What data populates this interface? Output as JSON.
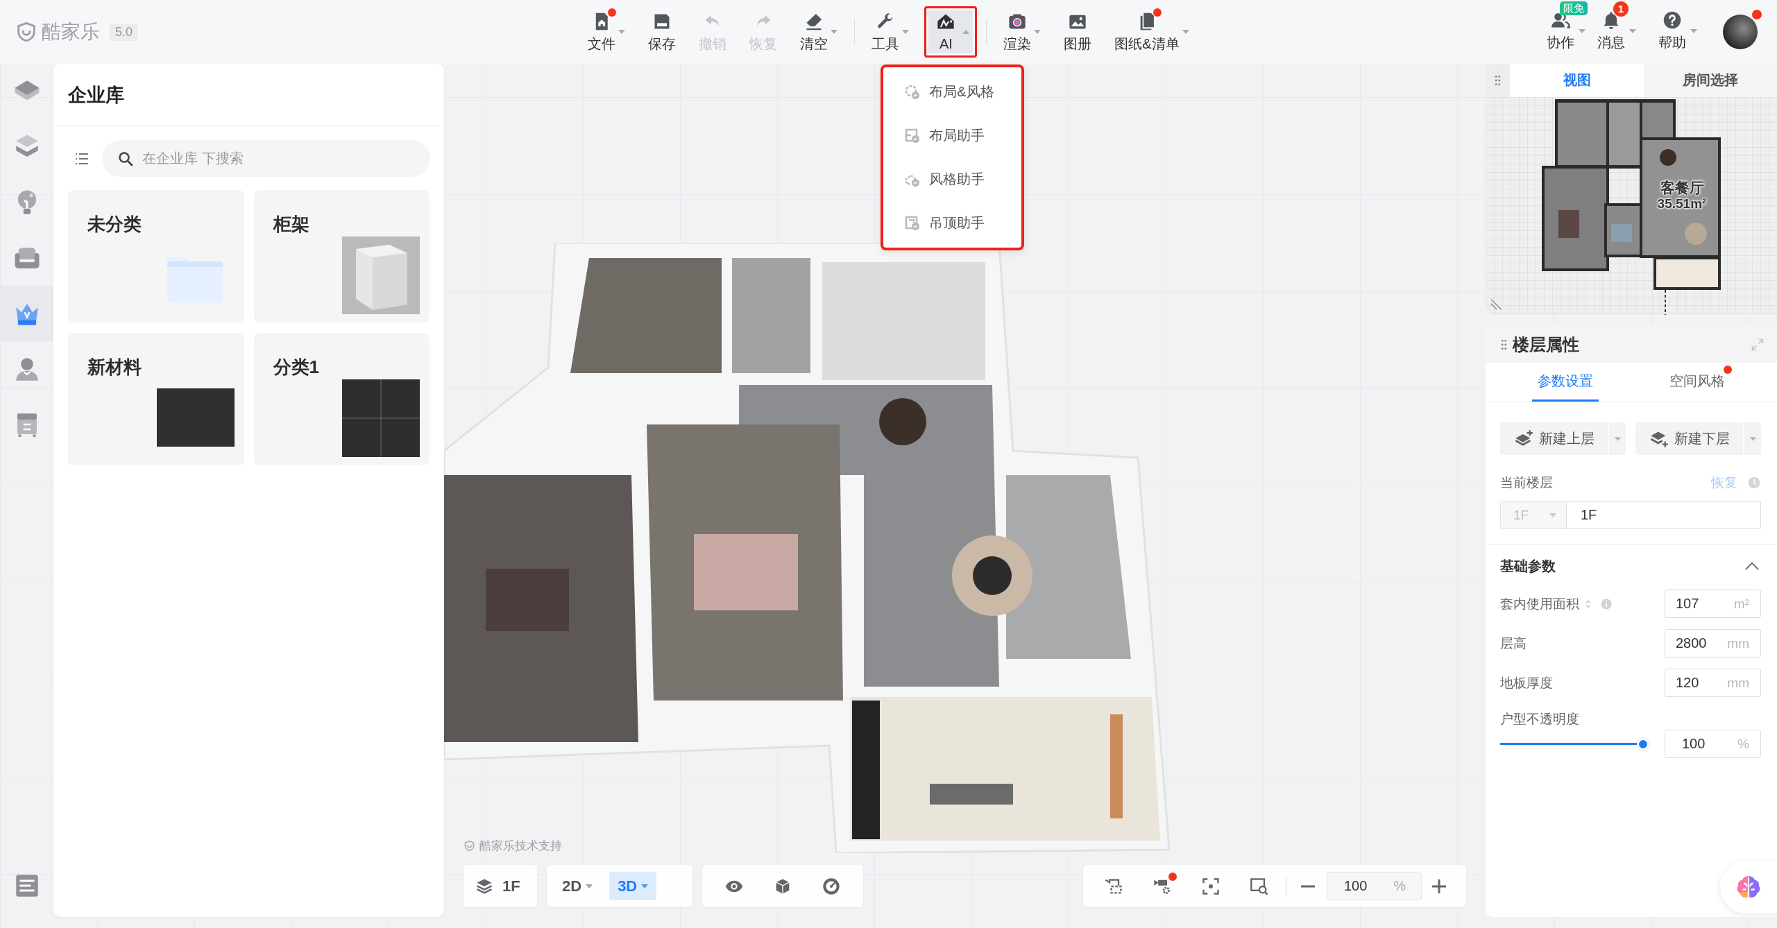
{
  "header": {
    "logo": "酷家乐",
    "version": "5.0"
  },
  "toolbar": [
    {
      "items": [
        {
          "label": "文件",
          "dropdown": true,
          "expanded": false,
          "disabled": false,
          "dot": true,
          "selected": false,
          "annotated": false
        },
        {
          "label": "保存",
          "dropdown": false,
          "disabled": false,
          "dot": false,
          "selected": false,
          "annotated": false
        },
        {
          "label": "撤销",
          "dropdown": false,
          "disabled": true,
          "dot": false,
          "selected": false,
          "annotated": false
        },
        {
          "label": "恢复",
          "dropdown": false,
          "disabled": true,
          "dot": false,
          "selected": false,
          "annotated": false
        },
        {
          "label": "清空",
          "dropdown": true,
          "expanded": false,
          "disabled": false,
          "dot": false,
          "selected": false,
          "annotated": false
        }
      ]
    },
    {
      "items": [
        {
          "label": "工具",
          "dropdown": true,
          "expanded": false,
          "disabled": false,
          "dot": false,
          "selected": false,
          "annotated": false
        },
        {
          "label": "AI",
          "dropdown": true,
          "expanded": true,
          "disabled": false,
          "dot": false,
          "selected": true,
          "annotated": true,
          "menu": {
            "annotated": true,
            "items": [
              {
                "label": "布局&风格"
              },
              {
                "label": "布局助手"
              },
              {
                "label": "风格助手"
              },
              {
                "label": "吊顶助手"
              }
            ]
          }
        }
      ]
    },
    {
      "items": [
        {
          "label": "渲染",
          "dropdown": true,
          "expanded": false,
          "disabled": false,
          "dot": false,
          "selected": false,
          "annotated": false
        },
        {
          "label": "图册",
          "dropdown": false,
          "disabled": false,
          "dot": false,
          "selected": false,
          "annotated": false
        },
        {
          "label": "图纸&清单",
          "dropdown": true,
          "expanded": false,
          "disabled": false,
          "dot": true,
          "selected": false,
          "annotated": false
        }
      ]
    }
  ],
  "account": {
    "tools": [
      {
        "label": "协作",
        "badge": {
          "text": "限免",
          "kind": "tag"
        },
        "dropdown": true
      },
      {
        "label": "消息",
        "badge": {
          "text": "1",
          "kind": "count"
        },
        "dropdown": true
      },
      {
        "label": "帮助",
        "dropdown": true
      }
    ],
    "avatar_dot": true
  },
  "sidebar": {
    "items": [
      {
        "selected": false
      },
      {
        "selected": false
      },
      {
        "selected": false
      },
      {
        "selected": false
      },
      {
        "selected": true
      },
      {
        "selected": false
      },
      {
        "selected": false
      }
    ],
    "bottom_items": [
      {
        "selected": false
      }
    ]
  },
  "library": {
    "title": "企业库",
    "search": {
      "placeholder": "在企业库 下搜索"
    },
    "categories": [
      {
        "name": "未分类",
        "kind": "folder"
      },
      {
        "name": "柜架",
        "kind": "box"
      },
      {
        "name": "新材料",
        "kind": "swatch"
      },
      {
        "name": "分类1",
        "kind": "tiles"
      }
    ]
  },
  "canvas": {
    "credit": "酷家乐技术支持",
    "floor": "1F",
    "view_modes": [
      {
        "label": "2D",
        "selected": false
      },
      {
        "label": "3D",
        "selected": true
      }
    ],
    "camera_tools": [
      {
        "dot": false
      },
      {
        "dot": true
      },
      {
        "dot": false
      },
      {
        "dot": false
      }
    ],
    "zoom": {
      "value": "100",
      "unit": "%"
    }
  },
  "minimap": {
    "tabs": [
      {
        "label": "视图",
        "selected": true
      },
      {
        "label": "房间选择",
        "selected": false
      }
    ],
    "room": {
      "name": "客餐厅",
      "area": "35.51m²"
    }
  },
  "floor_panel": {
    "title": "楼层属性",
    "tabs": [
      {
        "label": "参数设置",
        "selected": true,
        "dot": false
      },
      {
        "label": "空间风格",
        "selected": false,
        "dot": true
      }
    ],
    "actions": [
      {
        "label": "新建上层"
      },
      {
        "label": "新建下层"
      }
    ],
    "current_floor": {
      "label": "当前楼层",
      "restore": "恢复",
      "restore_disabled": true,
      "floor_select": "1F",
      "select_disabled": true,
      "name": "1F"
    },
    "basic": {
      "title": "基础参数",
      "expanded": true,
      "fields": [
        {
          "label": "套内使用面积",
          "kind": "area",
          "value": "107",
          "unit": "m²"
        },
        {
          "label": "层高",
          "kind": "plain",
          "value": "2800",
          "unit": "mm"
        },
        {
          "label": "地板厚度",
          "kind": "plain",
          "value": "120",
          "unit": "mm"
        }
      ],
      "opacity": {
        "label": "户型不透明度",
        "level": 1,
        "value": "100",
        "unit": "%"
      }
    }
  }
}
